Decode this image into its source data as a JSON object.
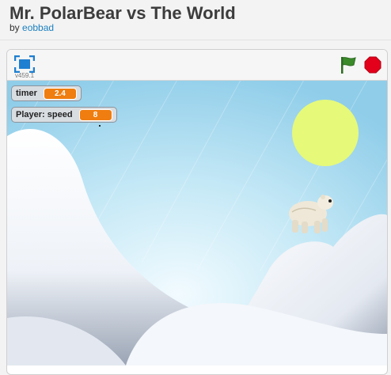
{
  "page": {
    "title": "Mr. PolarBear vs The World",
    "by_prefix": "by",
    "author": "eobbad"
  },
  "player": {
    "version": "v459.1",
    "icons": {
      "fullscreen": "fullscreen-icon",
      "green_flag": "green-flag-icon",
      "stop": "stop-sign-icon"
    },
    "colors": {
      "flag": "#3a8a2a",
      "stop": "#e3001b",
      "monitor_value_bg": "#ef7d0f",
      "sun": "#e6f979",
      "sky": "#a9d9ee"
    }
  },
  "monitors": {
    "timer": {
      "label": "timer",
      "value": "2.4"
    },
    "speed": {
      "label": "Player: speed",
      "value": "8"
    }
  }
}
